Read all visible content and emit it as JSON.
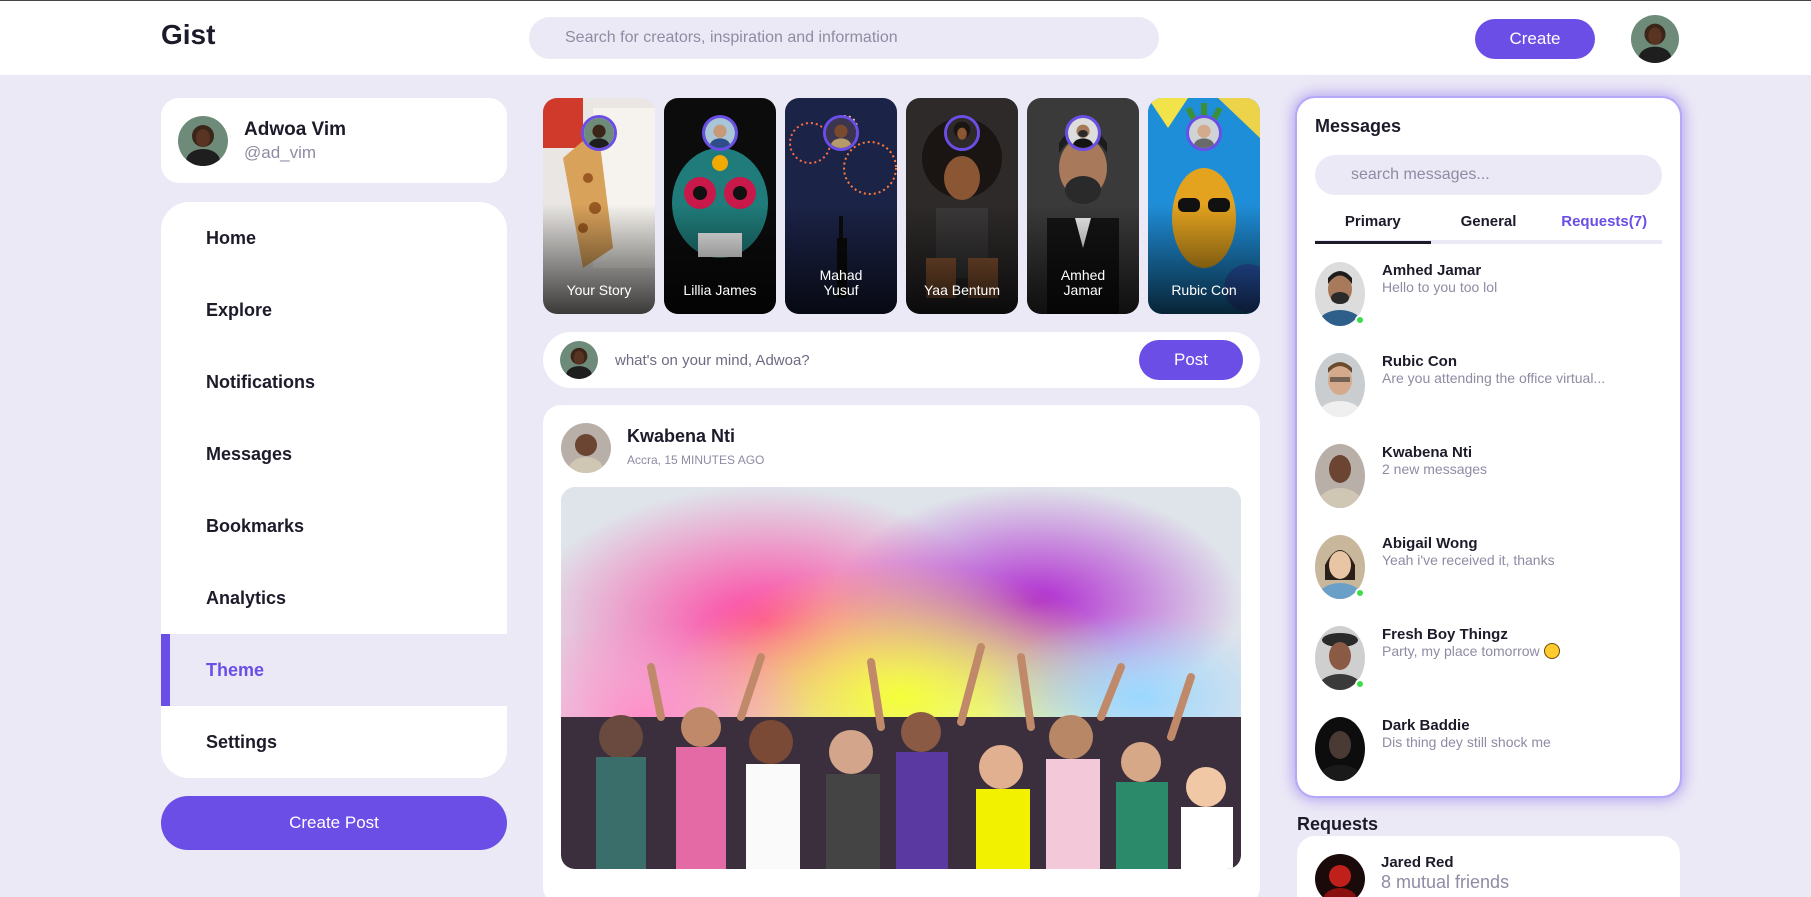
{
  "navbar": {
    "logo": "Gist",
    "search_placeholder": "Search for creators, inspiration and information",
    "create_label": "Create"
  },
  "profile": {
    "name": "Adwoa Vim",
    "handle": "@ad_vim"
  },
  "menu": {
    "items": [
      {
        "label": "Home"
      },
      {
        "label": "Explore"
      },
      {
        "label": "Notifications"
      },
      {
        "label": "Messages"
      },
      {
        "label": "Bookmarks"
      },
      {
        "label": "Analytics"
      },
      {
        "label": "Theme",
        "active": true
      },
      {
        "label": "Settings"
      }
    ],
    "create_post_label": "Create Post"
  },
  "stories": [
    {
      "name": "Your Story"
    },
    {
      "name": "Lillia James"
    },
    {
      "name": "Mahad\nYusuf"
    },
    {
      "name": "Yaa Bentum"
    },
    {
      "name": "Amhed\nJamar"
    },
    {
      "name": "Rubic Con"
    }
  ],
  "composer": {
    "placeholder": "what's on your mind, Adwoa?",
    "post_label": "Post"
  },
  "feed": {
    "author": "Kwabena Nti",
    "meta": "Accra, 15 MINUTES AGO"
  },
  "messages": {
    "title": "Messages",
    "search_placeholder": "search messages...",
    "tabs": [
      {
        "label": "Primary",
        "active": true
      },
      {
        "label": "General"
      },
      {
        "label": "Requests(7)"
      }
    ],
    "items": [
      {
        "name": "Amhed Jamar",
        "preview": "Hello to you too lol",
        "online": true
      },
      {
        "name": "Rubic Con",
        "preview": "Are you attending the office virtual...",
        "online": false
      },
      {
        "name": "Kwabena Nti",
        "preview": "2 new messages",
        "online": false
      },
      {
        "name": "Abigail Wong",
        "preview": "Yeah i've received it, thanks",
        "online": true
      },
      {
        "name": "Fresh Boy Thingz",
        "preview": "Party, my place tomorrow",
        "online": true
      },
      {
        "name": "Dark Baddie",
        "preview": "Dis thing dey still shock me",
        "online": false
      }
    ]
  },
  "requests": {
    "title": "Requests",
    "items": [
      {
        "name": "Jared Red",
        "mutual": "8 mutual friends"
      }
    ]
  },
  "colors": {
    "accent": "#6b4ee6",
    "background": "#ece9f6",
    "online": "#3ddc4a",
    "muted_text": "#8e8ba3"
  }
}
